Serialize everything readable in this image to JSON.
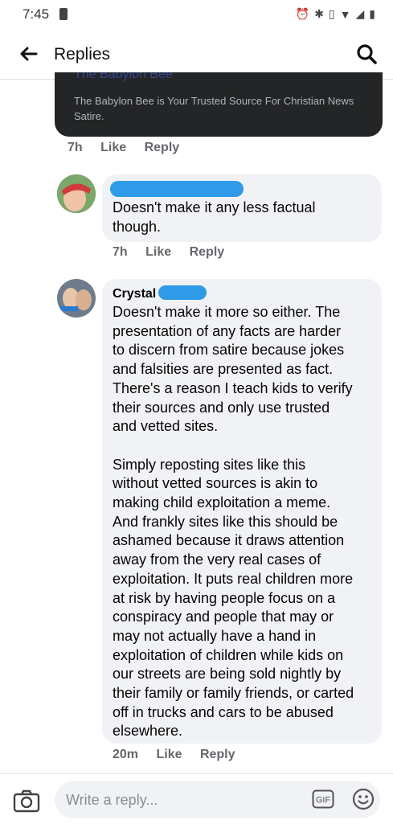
{
  "status_bar": {
    "time": "7:45"
  },
  "header": {
    "title": "Replies"
  },
  "link_card": {
    "site_title": "The Babylon Bee",
    "description": "The Babylon Bee is Your Trusted Source For Christian News Satire."
  },
  "link_card_meta": {
    "time": "7h",
    "like": "Like",
    "reply": "Reply"
  },
  "comments": [
    {
      "author": "",
      "text": "Doesn't make it any less factual\nthough.",
      "time": "7h",
      "like": "Like",
      "reply": "Reply"
    },
    {
      "author": "Crystal",
      "text": "Doesn't make it more so either. The\npresentation of any facts are harder\nto discern from satire because jokes\nand falsities are presented as fact.\nThere's a reason I teach kids to verify\ntheir sources and only use trusted\nand vetted sites.\n\nSimply reposting sites like this\nwithout vetted sources is akin to\nmaking child exploitation a meme.\nAnd frankly sites like this should be\nashamed because it draws attention\naway from the very real cases of\nexploitation. It puts real children more\nat risk by having people focus on a\nconspiracy and people that may or\nmay not actually have a hand in\nexploitation of children while kids on\nour streets are being sold nightly by\ntheir family or family friends, or carted\noff in trucks and cars to be abused\nelsewhere.",
      "time": "20m",
      "like": "Like",
      "reply": "Reply"
    }
  ],
  "composer": {
    "placeholder": "Write a reply...",
    "gif_label": "GIF"
  },
  "icons": [
    "back-arrow-icon",
    "search-icon",
    "camera-icon",
    "gif-icon",
    "emoji-icon",
    "alarm-icon",
    "bluetooth-icon",
    "vibrate-icon",
    "wifi-icon",
    "signal-icon",
    "battery-icon"
  ],
  "colors": {
    "redaction": "#2e9ae8",
    "bubble": "#f0f2f5",
    "meta": "#65676b",
    "card": "#242526"
  }
}
